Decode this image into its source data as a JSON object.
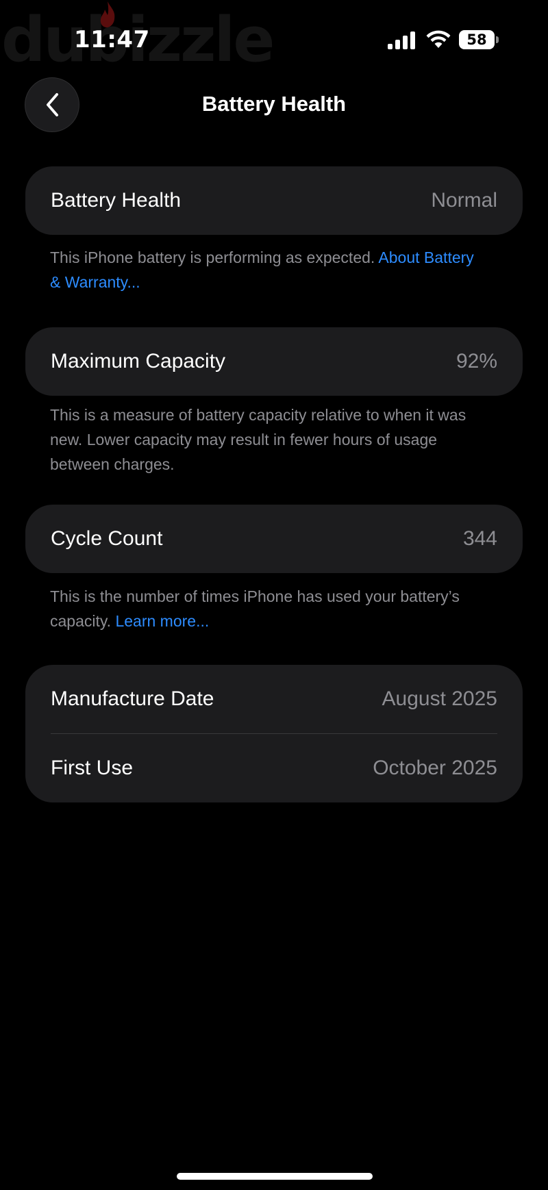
{
  "watermark": {
    "text": "dubizzle"
  },
  "status_bar": {
    "time": "11:47",
    "battery_level": "58"
  },
  "nav": {
    "title": "Battery Health"
  },
  "sections": {
    "health": {
      "label": "Battery Health",
      "value": "Normal",
      "footnote": "This iPhone battery is performing as expected. ",
      "link": "About Battery & Warranty..."
    },
    "capacity": {
      "label": "Maximum Capacity",
      "value": "92%",
      "footnote": "This is a measure of battery capacity relative to when it was new. Lower capacity may result in fewer hours of usage between charges."
    },
    "cycles": {
      "label": "Cycle Count",
      "value": "344",
      "footnote": "This is the number of times iPhone has used your battery’s capacity. ",
      "link": "Learn more..."
    },
    "dates": {
      "manufacture_label": "Manufacture Date",
      "manufacture_value": "August 2025",
      "first_use_label": "First Use",
      "first_use_value": "October 2025"
    }
  },
  "colors": {
    "background": "#000000",
    "card": "#1c1c1e",
    "secondary_text": "#8e8e93",
    "link": "#2d8cff"
  }
}
